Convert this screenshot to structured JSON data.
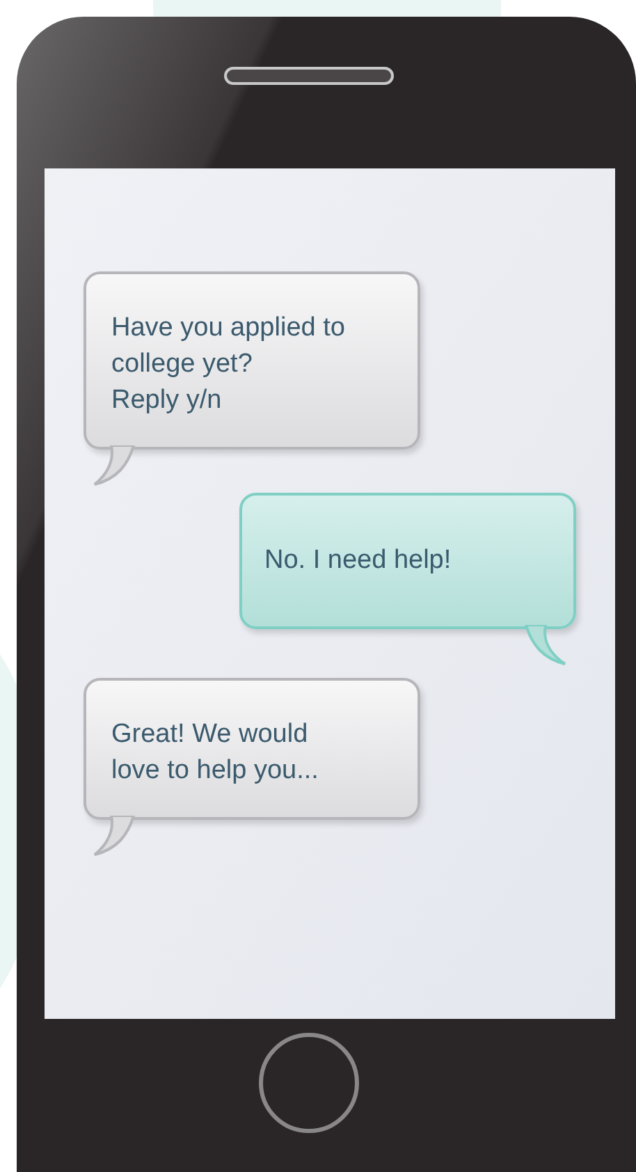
{
  "messages": [
    {
      "kind": "incoming",
      "text": "Have you applied to college yet?\nReply y/n"
    },
    {
      "kind": "outgoing",
      "text": "No. I need help!"
    },
    {
      "kind": "incoming",
      "text": "Great! We would\nlove to help you..."
    }
  ]
}
